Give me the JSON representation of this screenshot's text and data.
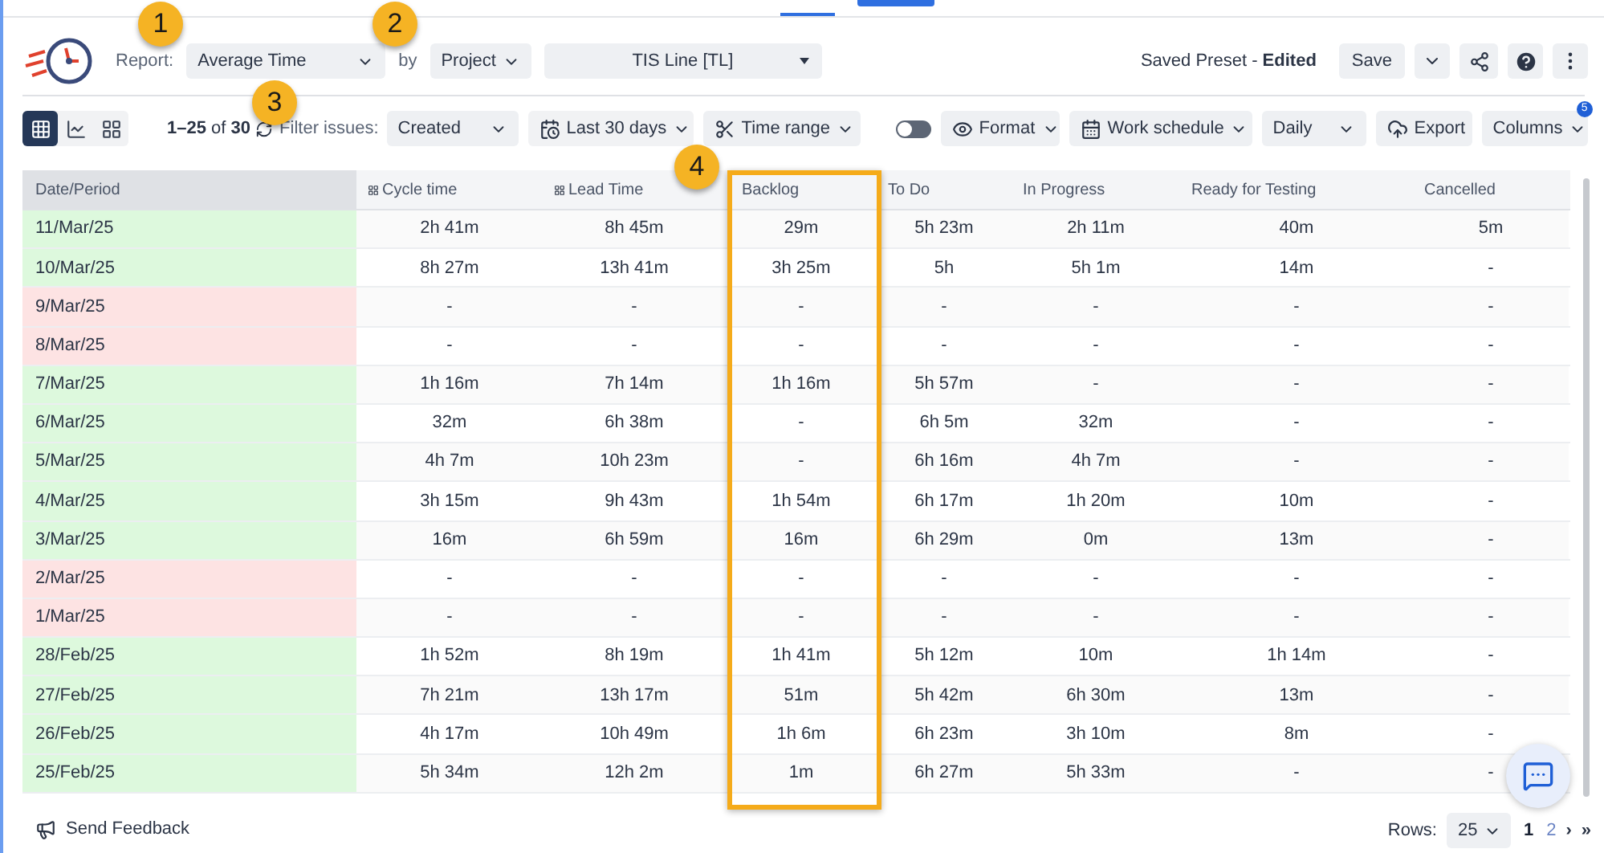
{
  "header": {
    "report_label": "Report:",
    "report": "Average Time",
    "by_label": "by",
    "group": "Project",
    "project": "TIS Line [TL]",
    "preset": "Saved Preset - **Edited**",
    "save": "Save"
  },
  "toolbar": {
    "views": [
      {
        "selected": true
      },
      {
        "selected": false
      },
      {
        "selected": false
      }
    ],
    "range_start": "1–25",
    "range_of": "of",
    "range_total": "30",
    "filter_label": "Filter issues:",
    "filter": "Created",
    "period": "Last 30 days",
    "time_range": "Time range",
    "toggle_on": false,
    "format": "Format",
    "schedule": "Work schedule",
    "granularity": "Daily",
    "export": "Export",
    "columns": "Columns",
    "columns_badge": "5"
  },
  "table": {
    "columns": [
      "Date/Period",
      "Cycle time",
      "Lead Time",
      "Backlog",
      "To Do",
      "In Progress",
      "Ready for Testing",
      "Cancelled"
    ],
    "rows": [
      {
        "weekend": false,
        "cells": [
          "11/Mar/25",
          "2h 41m",
          "8h 45m",
          "29m",
          "5h 23m",
          "2h 11m",
          "40m",
          "5m"
        ]
      },
      {
        "weekend": false,
        "cells": [
          "10/Mar/25",
          "8h 27m",
          "13h 41m",
          "3h 25m",
          "5h",
          "5h 1m",
          "14m",
          "-"
        ]
      },
      {
        "weekend": true,
        "cells": [
          "9/Mar/25",
          "-",
          "-",
          "-",
          "-",
          "-",
          "-",
          "-"
        ]
      },
      {
        "weekend": true,
        "cells": [
          "8/Mar/25",
          "-",
          "-",
          "-",
          "-",
          "-",
          "-",
          "-"
        ]
      },
      {
        "weekend": false,
        "cells": [
          "7/Mar/25",
          "1h 16m",
          "7h 14m",
          "1h 16m",
          "5h 57m",
          "-",
          "-",
          "-"
        ]
      },
      {
        "weekend": false,
        "cells": [
          "6/Mar/25",
          "32m",
          "6h 38m",
          "-",
          "6h 5m",
          "32m",
          "-",
          "-"
        ]
      },
      {
        "weekend": false,
        "cells": [
          "5/Mar/25",
          "4h 7m",
          "10h 23m",
          "-",
          "6h 16m",
          "4h 7m",
          "-",
          "-"
        ]
      },
      {
        "weekend": false,
        "cells": [
          "4/Mar/25",
          "3h 15m",
          "9h 43m",
          "1h 54m",
          "6h 17m",
          "1h 20m",
          "10m",
          "-"
        ]
      },
      {
        "weekend": false,
        "cells": [
          "3/Mar/25",
          "16m",
          "6h 59m",
          "16m",
          "6h 29m",
          "0m",
          "13m",
          "-"
        ]
      },
      {
        "weekend": true,
        "cells": [
          "2/Mar/25",
          "-",
          "-",
          "-",
          "-",
          "-",
          "-",
          "-"
        ]
      },
      {
        "weekend": true,
        "cells": [
          "1/Mar/25",
          "-",
          "-",
          "-",
          "-",
          "-",
          "-",
          "-"
        ]
      },
      {
        "weekend": false,
        "cells": [
          "28/Feb/25",
          "1h 52m",
          "8h 19m",
          "1h 41m",
          "5h 12m",
          "10m",
          "1h 14m",
          "-"
        ]
      },
      {
        "weekend": false,
        "cells": [
          "27/Feb/25",
          "7h 21m",
          "13h 17m",
          "51m",
          "5h 42m",
          "6h 30m",
          "13m",
          "-"
        ]
      },
      {
        "weekend": false,
        "cells": [
          "26/Feb/25",
          "4h 17m",
          "10h 49m",
          "1h 6m",
          "6h 23m",
          "3h 10m",
          "8m",
          "-"
        ]
      },
      {
        "weekend": false,
        "cells": [
          "25/Feb/25",
          "5h 34m",
          "12h 2m",
          "1m",
          "6h 27m",
          "5h 33m",
          "-",
          "-"
        ]
      }
    ]
  },
  "footer": {
    "feedback": "Send Feedback",
    "rows_label": "Rows:",
    "rows_value": "25",
    "pages": [
      {
        "label": "1",
        "selected": true
      },
      {
        "label": "2",
        "selected": false
      }
    ],
    "next": "›",
    "last": "»"
  },
  "callouts": [
    "1",
    "2",
    "3",
    "4"
  ]
}
